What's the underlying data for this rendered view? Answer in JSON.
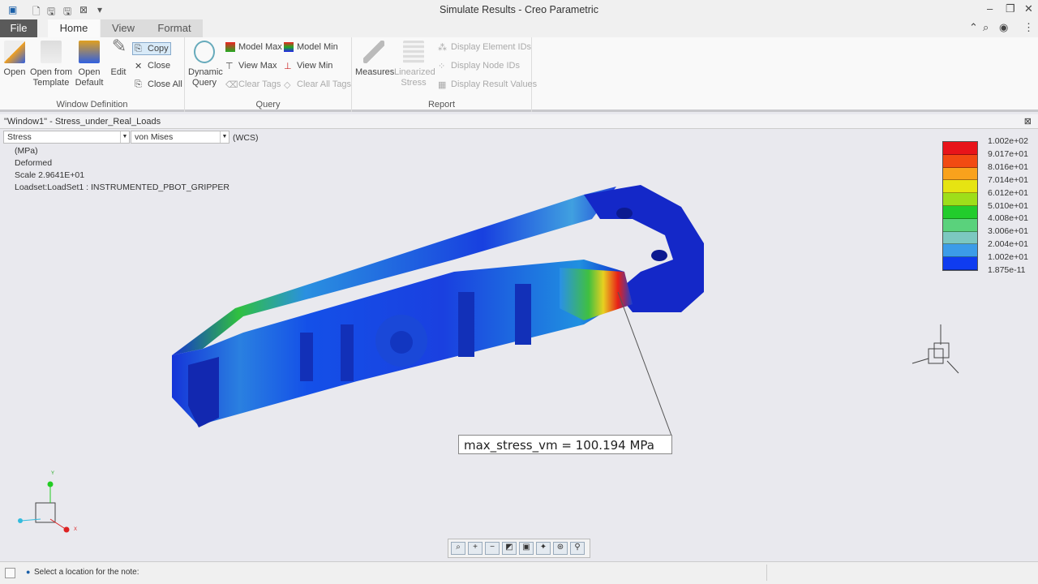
{
  "app": {
    "title": "Simulate Results - Creo Parametric"
  },
  "tabs": [
    {
      "label": "File"
    },
    {
      "label": "Home"
    },
    {
      "label": "View"
    },
    {
      "label": "Format"
    }
  ],
  "ribbon": {
    "window_definition": {
      "label": "Window Definition",
      "open": "Open",
      "open_template": "Open from Template",
      "open_default": "Open Default",
      "edit": "Edit",
      "copy": "Copy",
      "close": "Close",
      "close_all": "Close All"
    },
    "query": {
      "label": "Query",
      "dynamic_query": "Dynamic Query",
      "model_max": "Model Max",
      "model_min": "Model Min",
      "view_max": "View Max",
      "view_min": "View Min",
      "clear_tags": "Clear Tags",
      "clear_all_tags": "Clear All Tags"
    },
    "report": {
      "label": "Report",
      "measures": "Measures",
      "linearized_stress": "Linearized Stress",
      "display_element_ids": "Display Element IDs",
      "display_node_ids": "Display Node IDs",
      "display_result_values": "Display Result Values"
    }
  },
  "window": {
    "title": "\"Window1\" - Stress_under_Real_Loads",
    "quantity": "Stress",
    "component": "von Mises",
    "csys": "(WCS)",
    "info": [
      "(MPa)",
      "Deformed",
      "Scale  2.9641E+01",
      "Loadset:LoadSet1 :  INSTRUMENTED_PBOT_GRIPPER"
    ]
  },
  "legend": {
    "labels": [
      "1.002e+02",
      "9.017e+01",
      "8.016e+01",
      "7.014e+01",
      "6.012e+01",
      "5.010e+01",
      "4.008e+01",
      "3.006e+01",
      "2.004e+01",
      "1.002e+01",
      "1.875e-11"
    ],
    "colors": [
      "#e8141a",
      "#f24a12",
      "#f9a21c",
      "#e6e412",
      "#9ede1a",
      "#22cc2c",
      "#5ad27c",
      "#7cc8c0",
      "#3c9ce8",
      "#0f3cf0"
    ]
  },
  "note": "max_stress_vm  =  100.194  MPa",
  "status": {
    "message": "Select a location for the note:"
  }
}
